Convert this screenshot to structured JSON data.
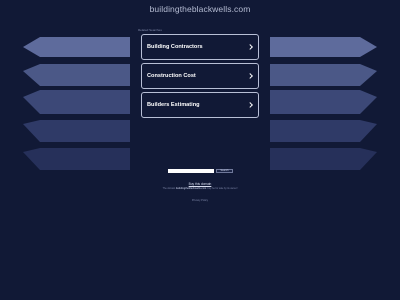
{
  "header": {
    "domain": "buildingtheblackwells.com"
  },
  "related": {
    "caption": "Related Searches",
    "links": [
      {
        "label": "Building Contractors"
      },
      {
        "label": "Construction Cost"
      },
      {
        "label": "Builders Estimating"
      }
    ]
  },
  "search": {
    "placeholder": "",
    "button_label": "Search"
  },
  "footer": {
    "buy_label": "Buy this domain",
    "notice_prefix": "The domain ",
    "notice_domain": "buildingtheblackwells.com",
    "notice_suffix": " may be for sale by its owner!",
    "privacy_label": "Privacy Policy"
  },
  "colors": {
    "background": "#111936",
    "link_border": "#b8bfd6",
    "stripes": [
      "#5e6b9c",
      "#4b5887",
      "#3c4877",
      "#2f3a67",
      "#26305a"
    ]
  }
}
